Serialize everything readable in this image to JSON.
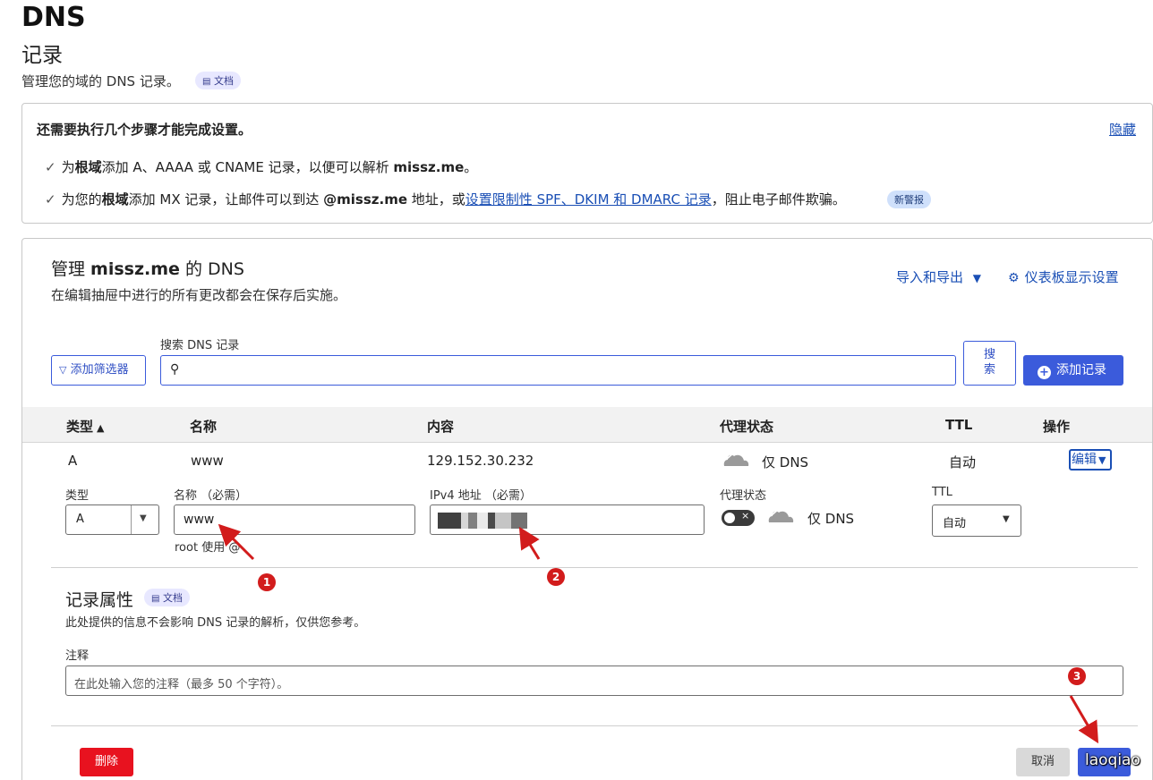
{
  "header": {
    "title": "DNS",
    "subtitle": "记录",
    "description": "管理您的域的 DNS 记录。",
    "docs_badge": "文档"
  },
  "setup": {
    "heading": "还需要执行几个步骤才能完成设置。",
    "hide_link": "隐藏",
    "step1_pre": "为",
    "step1_bold": "根域",
    "step1_mid": "添加 A、AAAA 或 CNAME 记录，以便可以解析 ",
    "step1_domain": "missz.me",
    "step1_end": "。",
    "step2_pre": "为您的",
    "step2_bold": "根域",
    "step2_mid": "添加 MX 记录，让邮件可以到达 ",
    "step2_domain": "@missz.me",
    "step2_after": " 地址，或",
    "step2_link": "设置限制性 SPF、DKIM 和 DMARC 记录",
    "step2_end": "，阻止电子邮件欺骗。",
    "new_badge": "新警报"
  },
  "manage": {
    "title_pre": "管理 ",
    "title_domain": "missz.me",
    "title_post": " 的 DNS",
    "subtitle": "在编辑抽屉中进行的所有更改都会在保存后实施。",
    "import_export": "导入和导出",
    "dashboard_settings": "仪表板显示设置",
    "search_label": "搜索 DNS 记录",
    "add_filter": "添加筛选器",
    "search_button": "搜索",
    "add_record": "添加记录"
  },
  "table": {
    "headers": {
      "type": "类型",
      "name": "名称",
      "content": "内容",
      "proxy": "代理状态",
      "ttl": "TTL",
      "actions": "操作"
    },
    "row": {
      "type": "A",
      "name": "www",
      "content": "129.152.30.232",
      "proxy": "仅 DNS",
      "ttl": "自动",
      "edit": "编辑"
    }
  },
  "editor": {
    "type_label": "类型",
    "type_value": "A",
    "name_label": "名称 （必需）",
    "name_value": "www",
    "name_hint": "root 使用 @",
    "ipv4_label": "IPv4 地址 （必需）",
    "proxy_label": "代理状态",
    "proxy_value": "仅 DNS",
    "ttl_label": "TTL",
    "ttl_value": "自动",
    "record_attrs_title": "记录属性",
    "record_attrs_docs": "文档",
    "record_attrs_desc": "此处提供的信息不会影响 DNS 记录的解析，仅供您参考。",
    "comment_label": "注释",
    "comment_placeholder": "在此处输入您的注释（最多 50 个字符）。",
    "delete_button": "删除",
    "cancel_button": "取消"
  },
  "annotations": {
    "marker1": "1",
    "marker2": "2",
    "marker3": "3",
    "watermark": "laoqiao"
  },
  "colors": {
    "accent": "#3b5bdb",
    "link": "#1a4fb5",
    "danger": "#e8121f",
    "annotation": "#d21c1c"
  }
}
